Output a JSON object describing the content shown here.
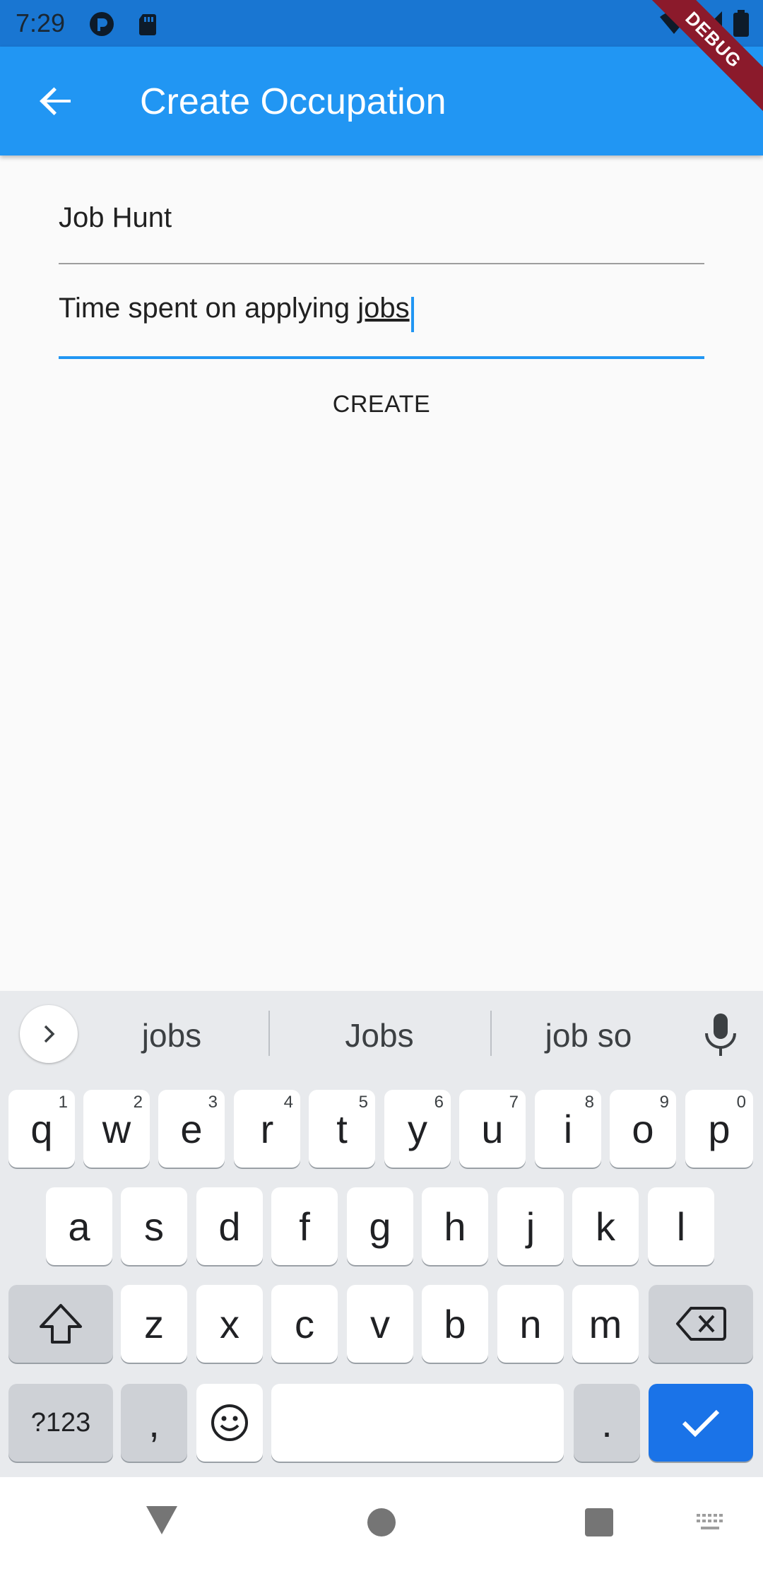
{
  "status_bar": {
    "time": "7:29"
  },
  "app_bar": {
    "title": "Create Occupation",
    "debug_label": "DEBUG"
  },
  "form": {
    "name_value": "Job Hunt",
    "description_prefix": "Time spent on applying ",
    "description_composing": "jobs",
    "create_label": "CREATE"
  },
  "keyboard": {
    "suggestions": [
      "jobs",
      "Jobs",
      "job so"
    ],
    "row1": [
      {
        "key": "q",
        "hint": "1"
      },
      {
        "key": "w",
        "hint": "2"
      },
      {
        "key": "e",
        "hint": "3"
      },
      {
        "key": "r",
        "hint": "4"
      },
      {
        "key": "t",
        "hint": "5"
      },
      {
        "key": "y",
        "hint": "6"
      },
      {
        "key": "u",
        "hint": "7"
      },
      {
        "key": "i",
        "hint": "8"
      },
      {
        "key": "o",
        "hint": "9"
      },
      {
        "key": "p",
        "hint": "0"
      }
    ],
    "row2": [
      "a",
      "s",
      "d",
      "f",
      "g",
      "h",
      "j",
      "k",
      "l"
    ],
    "row3": [
      "z",
      "x",
      "c",
      "v",
      "b",
      "n",
      "m"
    ],
    "symbols_label": "?123",
    "comma_label": ",",
    "period_label": "."
  },
  "colors": {
    "app_bar": "#2196f3",
    "status_bar": "#1976d2",
    "accent": "#2196f3",
    "keyboard_action": "#1a73e8"
  }
}
